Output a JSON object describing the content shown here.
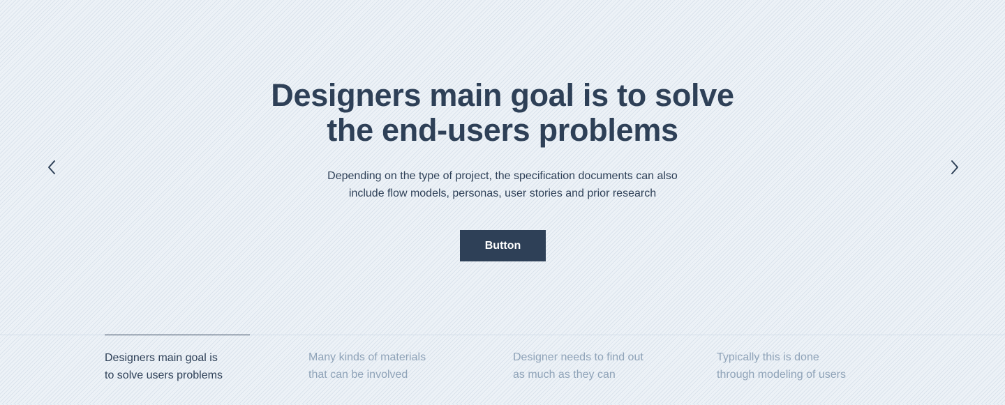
{
  "hero": {
    "title_line1": "Designers main goal is to solve",
    "title_line2": "the end-users problems",
    "subtitle_line1": "Depending on the type of project, the specification documents can also",
    "subtitle_line2": "include flow models, personas, user stories and prior research",
    "button_label": "Button"
  },
  "nav": {
    "prev_icon": "chevron-left-icon",
    "next_icon": "chevron-right-icon"
  },
  "tabs": [
    {
      "line1": "Designers main goal is",
      "line2": "to solve users problems",
      "active": true
    },
    {
      "line1": "Many kinds of materials",
      "line2": "that can be involved",
      "active": false
    },
    {
      "line1": "Designer needs to find out",
      "line2": "as much as they can",
      "active": false
    },
    {
      "line1": "Typically this is done",
      "line2": "through modeling of users",
      "active": false
    }
  ],
  "colors": {
    "primary": "#2e4057",
    "muted_text": "#8fa3b8",
    "background": "#edf2f7",
    "divider": "#d2dde8"
  }
}
